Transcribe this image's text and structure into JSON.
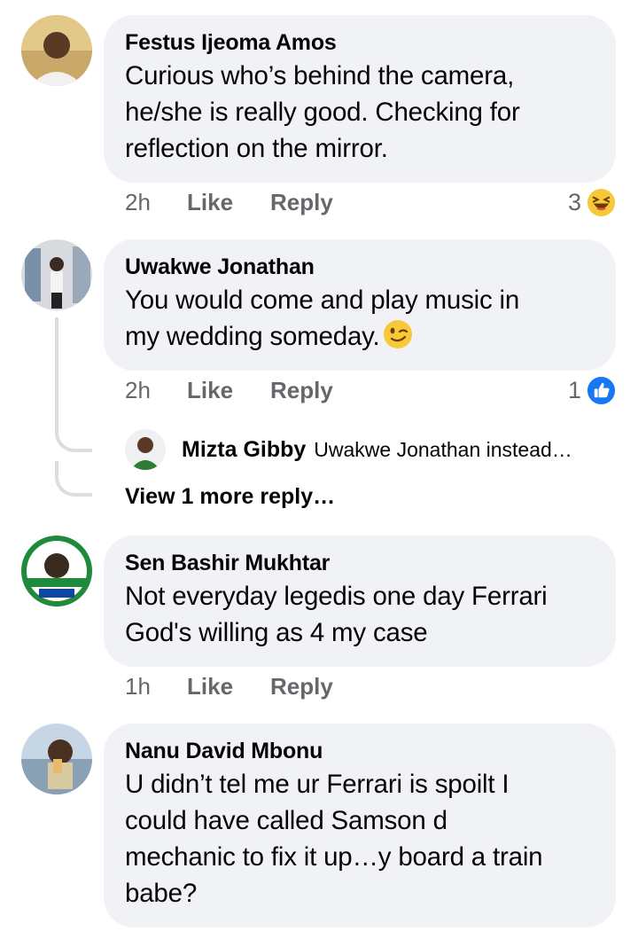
{
  "comments": [
    {
      "author": "Festus Ijeoma Amos",
      "lines": [
        "Curious who’s behind the camera,",
        "he/she is really good. Checking for",
        "reflection on the mirror."
      ],
      "time": "2h",
      "like": "Like",
      "reply": "Reply",
      "reaction_count": "3",
      "reaction_icon": "laughing-emoji-icon"
    },
    {
      "author": "Uwakwe Jonathan",
      "lines": [
        "You would come and play music in",
        "my wedding someday."
      ],
      "time": "2h",
      "like": "Like",
      "reply": "Reply",
      "reaction_count": "1",
      "reaction_icon": "thumbs-up-icon",
      "reply_preview": {
        "author": "Mizta Gibby",
        "text": "Uwakwe Jonathan instead…"
      },
      "view_more": "View 1 more reply…"
    },
    {
      "author": "Sen Bashir Mukhtar",
      "lines": [
        "Not everyday legedis one day Ferrari",
        "God's willing as 4 my case"
      ],
      "time": "1h",
      "like": "Like",
      "reply": "Reply"
    },
    {
      "author": "Nanu David Mbonu",
      "lines": [
        "U didn’t tel me ur Ferrari is spoilt I",
        "could have called Samson d",
        "mechanic to fix it up…y board a train",
        "babe?"
      ]
    }
  ],
  "colors": {
    "bubble": "#f0f2f5",
    "meta_text": "#65676b",
    "like_blue": "#1877f2",
    "laugh_yellow": "#f7c93a"
  }
}
